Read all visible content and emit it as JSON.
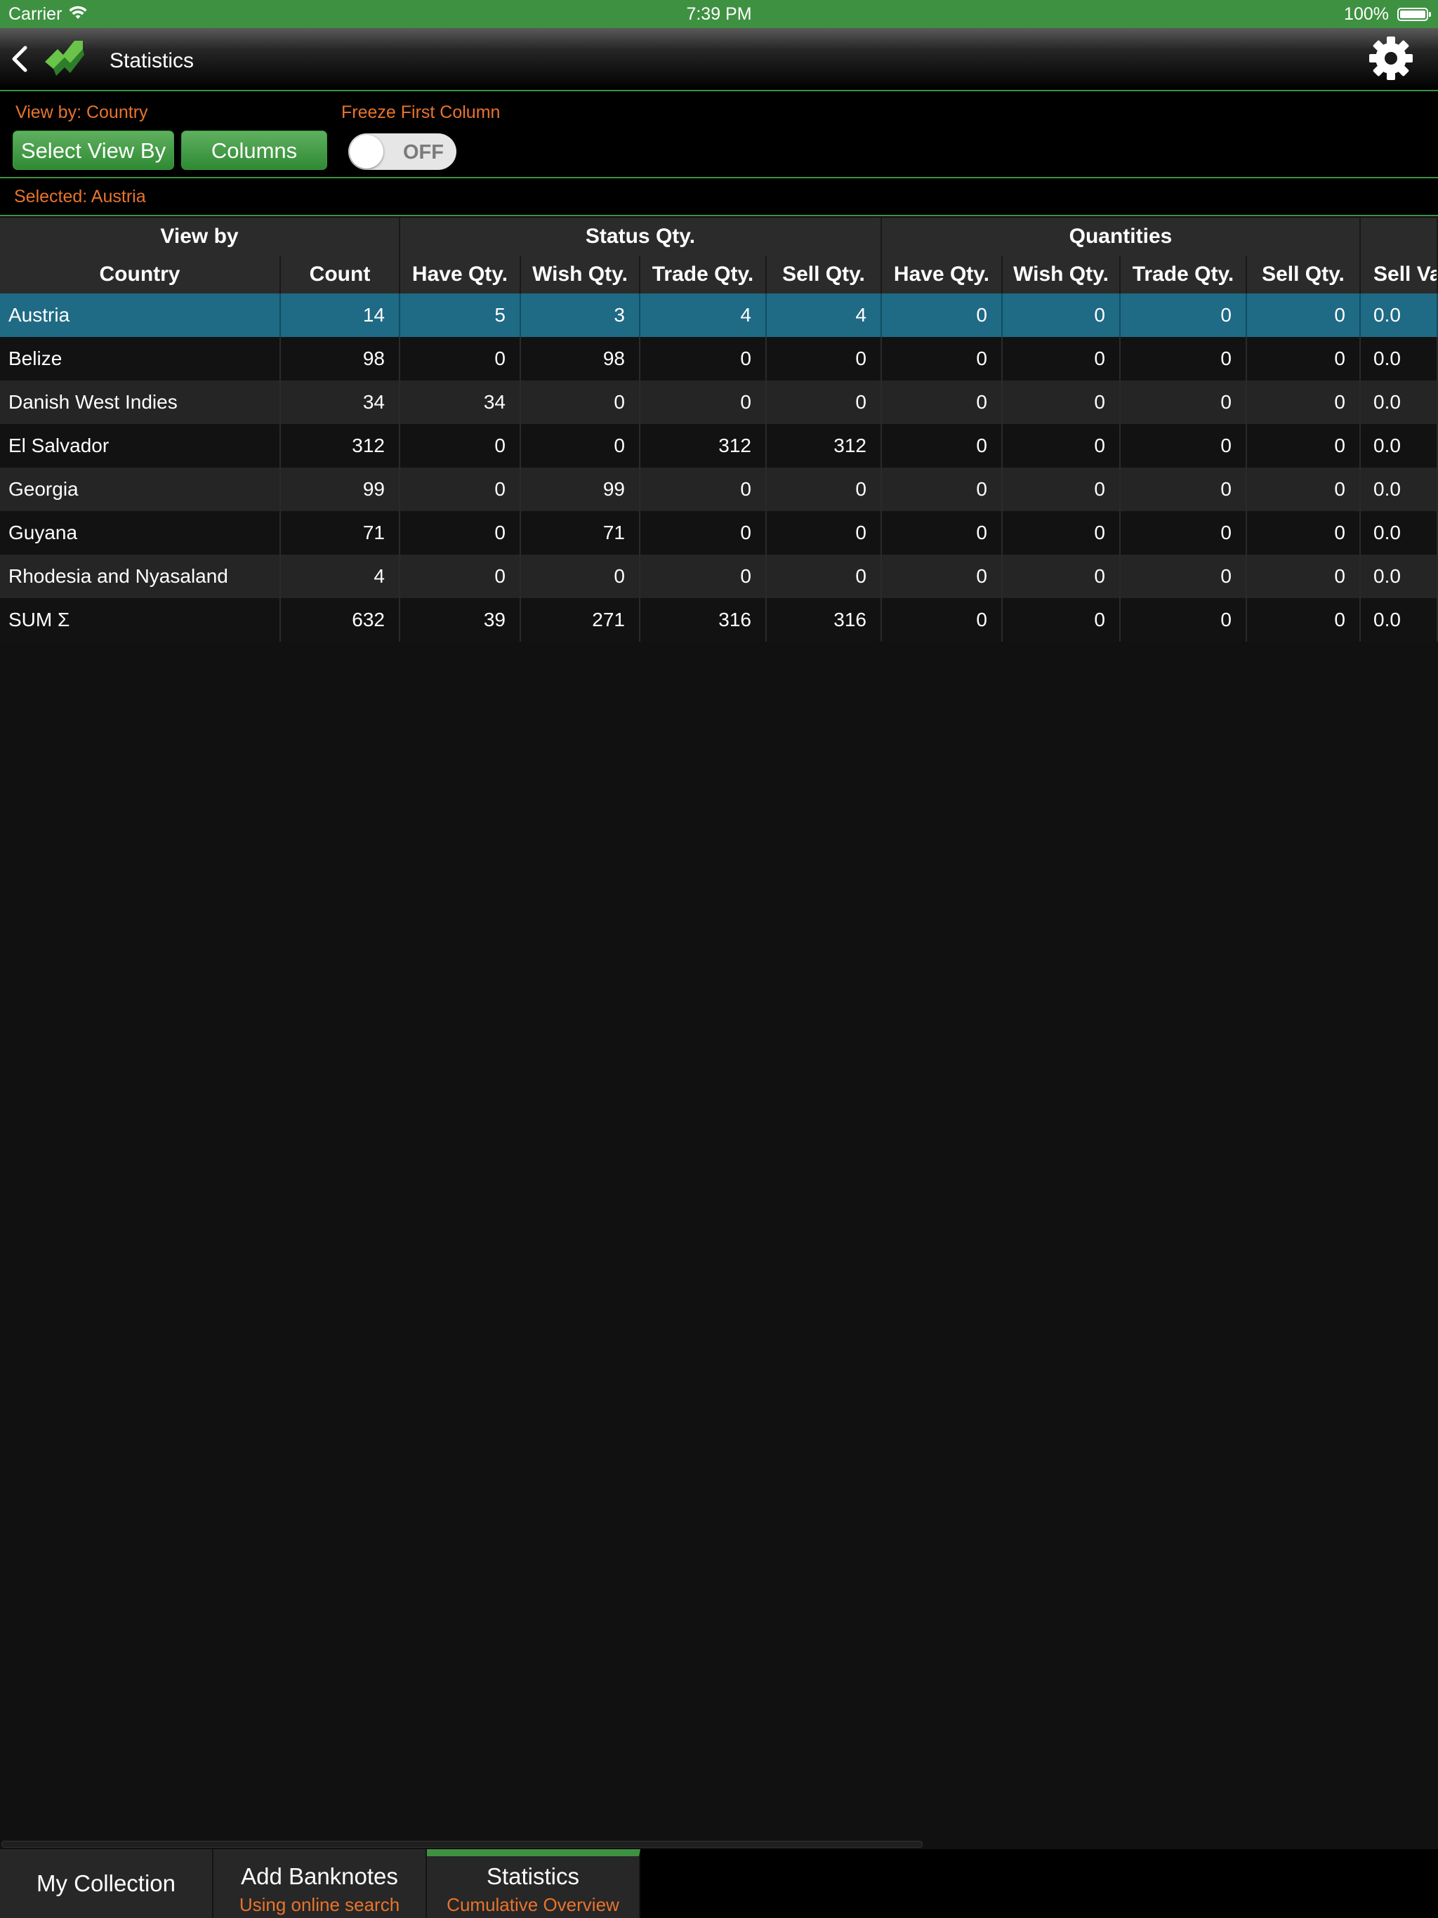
{
  "status_bar": {
    "carrier": "Carrier",
    "time": "7:39 PM",
    "battery": "100%"
  },
  "nav": {
    "title": "Statistics",
    "icons": [
      "chevron-left-icon",
      "app-logo-icon",
      "gear-icon"
    ]
  },
  "controls": {
    "view_by_label": "View by: Country",
    "freeze_label": "Freeze First Column",
    "select_view_by": "Select View By",
    "columns": "Columns",
    "freeze_toggle": "OFF",
    "selected": "Selected: Austria"
  },
  "table": {
    "group_headers": [
      "View by",
      "Status Qty.",
      "Quantities",
      ""
    ],
    "column_headers": [
      "Country",
      "Count",
      "Have Qty.",
      "Wish Qty.",
      "Trade Qty.",
      "Sell Qty.",
      "Have Qty.",
      "Wish Qty.",
      "Trade Qty.",
      "Sell Qty.",
      "Sell Va"
    ],
    "rows": [
      [
        "Austria",
        "14",
        "5",
        "3",
        "4",
        "4",
        "0",
        "0",
        "0",
        "0",
        "0.0"
      ],
      [
        "Belize",
        "98",
        "0",
        "98",
        "0",
        "0",
        "0",
        "0",
        "0",
        "0",
        "0.0"
      ],
      [
        "Danish West Indies",
        "34",
        "34",
        "0",
        "0",
        "0",
        "0",
        "0",
        "0",
        "0",
        "0.0"
      ],
      [
        "El Salvador",
        "312",
        "0",
        "0",
        "312",
        "312",
        "0",
        "0",
        "0",
        "0",
        "0.0"
      ],
      [
        "Georgia",
        "99",
        "0",
        "99",
        "0",
        "0",
        "0",
        "0",
        "0",
        "0",
        "0.0"
      ],
      [
        "Guyana",
        "71",
        "0",
        "71",
        "0",
        "0",
        "0",
        "0",
        "0",
        "0",
        "0.0"
      ],
      [
        "Rhodesia and Nyasaland",
        "4",
        "0",
        "0",
        "0",
        "0",
        "0",
        "0",
        "0",
        "0",
        "0.0"
      ],
      [
        "SUM Σ",
        "632",
        "39",
        "271",
        "316",
        "316",
        "0",
        "0",
        "0",
        "0",
        "0.0"
      ]
    ],
    "selected_row": "Austria"
  },
  "tabs": [
    {
      "title": "My Collection",
      "subtitle": ""
    },
    {
      "title": "Add Banknotes",
      "subtitle": "Using online search"
    },
    {
      "title": "Statistics",
      "subtitle": "Cumulative Overview"
    }
  ],
  "colors": {
    "accent_green": "#3f9142",
    "orange": "#e8742b",
    "selected_row": "#1f6a85"
  }
}
